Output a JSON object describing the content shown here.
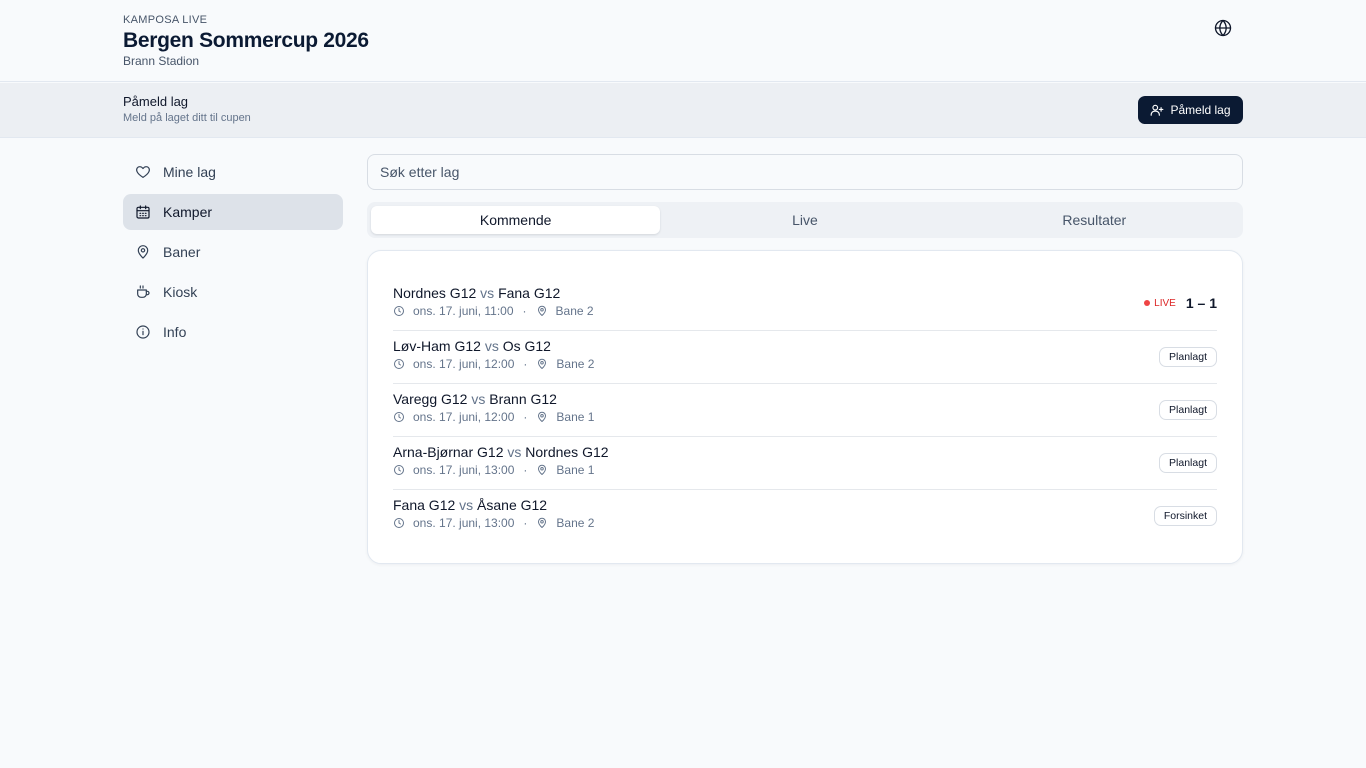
{
  "header": {
    "brand": "KAMPOSA LIVE",
    "title": "Bergen Sommercup 2026",
    "venue": "Brann Stadion",
    "language_icon": "globe-icon"
  },
  "banner": {
    "title": "Påmeld lag",
    "subtitle": "Meld på laget ditt til cupen",
    "button_label": "Påmeld lag",
    "button_icon": "user-plus-icon"
  },
  "sidebar": {
    "items": [
      {
        "label": "Mine lag",
        "icon": "heart-icon",
        "active": false
      },
      {
        "label": "Kamper",
        "icon": "calendar-icon",
        "active": true
      },
      {
        "label": "Baner",
        "icon": "map-pin-icon",
        "active": false
      },
      {
        "label": "Kiosk",
        "icon": "coffee-icon",
        "active": false
      },
      {
        "label": "Info",
        "icon": "info-icon",
        "active": false
      }
    ]
  },
  "search": {
    "placeholder": "Søk etter lag",
    "value": ""
  },
  "tabs": [
    {
      "label": "Kommende",
      "active": true
    },
    {
      "label": "Live",
      "active": false
    },
    {
      "label": "Resultater",
      "active": false
    }
  ],
  "matches": [
    {
      "home": "Nordnes G12",
      "vs": "vs",
      "away": "Fana G12",
      "time": "ons. 17. juni, 11:00",
      "sep": "·",
      "pitch": "Bane 2",
      "live": true,
      "live_label": "LIVE",
      "score": "1 – 1"
    },
    {
      "home": "Løv-Ham G12",
      "vs": "vs",
      "away": "Os G12",
      "time": "ons. 17. juni, 12:00",
      "sep": "·",
      "pitch": "Bane 2",
      "status": "Planlagt"
    },
    {
      "home": "Varegg G12",
      "vs": "vs",
      "away": "Brann G12",
      "time": "ons. 17. juni, 12:00",
      "sep": "·",
      "pitch": "Bane 1",
      "status": "Planlagt"
    },
    {
      "home": "Arna-Bjørnar G12",
      "vs": "vs",
      "away": "Nordnes G12",
      "time": "ons. 17. juni, 13:00",
      "sep": "·",
      "pitch": "Bane 1",
      "status": "Planlagt"
    },
    {
      "home": "Fana G12",
      "vs": "vs",
      "away": "Åsane G12",
      "time": "ons. 17. juni, 13:00",
      "sep": "·",
      "pitch": "Bane 2",
      "status": "Forsinket"
    }
  ],
  "colors": {
    "primary": "#0b1a33",
    "live": "#ef4444",
    "background": "#f8fafc"
  }
}
